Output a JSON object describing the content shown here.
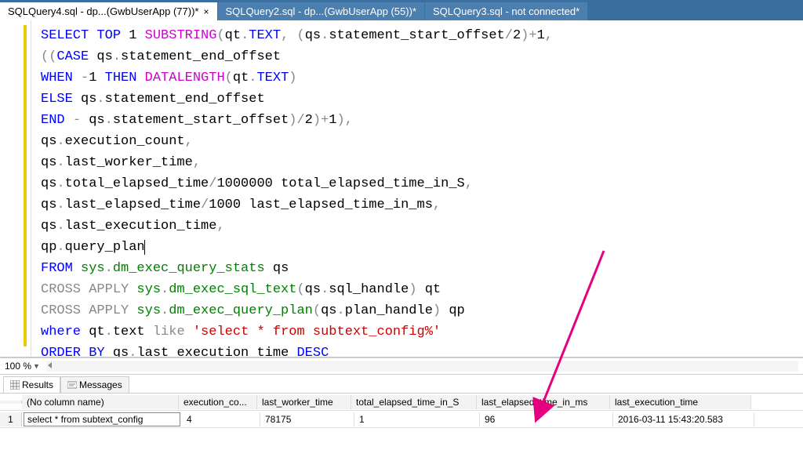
{
  "tabs": [
    {
      "label": "SQLQuery4.sql - dp...(GwbUserApp (77))*",
      "active": true
    },
    {
      "label": "SQLQuery2.sql - dp...(GwbUserApp (55))*",
      "active": false
    },
    {
      "label": "SQLQuery3.sql - not connected*",
      "active": false
    }
  ],
  "zoom": "100 %",
  "panels": {
    "results": "Results",
    "messages": "Messages"
  },
  "code_tokens": [
    [
      [
        "kw",
        "SELECT"
      ],
      [
        "",
        ""
      ],
      [
        "kw",
        "TOP"
      ],
      [
        "",
        " "
      ],
      [
        "num",
        "1"
      ],
      [
        "",
        " "
      ],
      [
        "fn",
        "SUBSTRING"
      ],
      [
        "punct",
        "("
      ],
      [
        "ident",
        "qt"
      ],
      [
        "punct",
        "."
      ],
      [
        "kw",
        "TEXT"
      ],
      [
        "punct",
        ","
      ],
      [
        "",
        " "
      ],
      [
        "punct",
        "("
      ],
      [
        "ident",
        "qs"
      ],
      [
        "punct",
        "."
      ],
      [
        "ident",
        "statement_start_offset"
      ],
      [
        "op",
        "/"
      ],
      [
        "num",
        "2"
      ],
      [
        "punct",
        ")"
      ],
      [
        "op",
        "+"
      ],
      [
        "num",
        "1"
      ],
      [
        "punct",
        ","
      ]
    ],
    [
      [
        "punct",
        "(("
      ],
      [
        "kw",
        "CASE"
      ],
      [
        "",
        " "
      ],
      [
        "ident",
        "qs"
      ],
      [
        "punct",
        "."
      ],
      [
        "ident",
        "statement_end_offset"
      ]
    ],
    [
      [
        "kw",
        "WHEN"
      ],
      [
        "",
        " "
      ],
      [
        "op",
        "-"
      ],
      [
        "num",
        "1"
      ],
      [
        "",
        " "
      ],
      [
        "kw",
        "THEN"
      ],
      [
        "",
        " "
      ],
      [
        "fn",
        "DATALENGTH"
      ],
      [
        "punct",
        "("
      ],
      [
        "ident",
        "qt"
      ],
      [
        "punct",
        "."
      ],
      [
        "kw",
        "TEXT"
      ],
      [
        "punct",
        ")"
      ]
    ],
    [
      [
        "kw",
        "ELSE"
      ],
      [
        "",
        " "
      ],
      [
        "ident",
        "qs"
      ],
      [
        "punct",
        "."
      ],
      [
        "ident",
        "statement_end_offset"
      ]
    ],
    [
      [
        "kw",
        "END"
      ],
      [
        "",
        " "
      ],
      [
        "op",
        "-"
      ],
      [
        "",
        " "
      ],
      [
        "ident",
        "qs"
      ],
      [
        "punct",
        "."
      ],
      [
        "ident",
        "statement_start_offset"
      ],
      [
        "punct",
        ")"
      ],
      [
        "op",
        "/"
      ],
      [
        "num",
        "2"
      ],
      [
        "punct",
        ")"
      ],
      [
        "op",
        "+"
      ],
      [
        "num",
        "1"
      ],
      [
        "punct",
        ")"
      ],
      [
        "punct",
        ","
      ]
    ],
    [
      [
        "ident",
        "qs"
      ],
      [
        "punct",
        "."
      ],
      [
        "ident",
        "execution_count"
      ],
      [
        "punct",
        ","
      ]
    ],
    [
      [
        "ident",
        "qs"
      ],
      [
        "punct",
        "."
      ],
      [
        "ident",
        "last_worker_time"
      ],
      [
        "punct",
        ","
      ]
    ],
    [
      [
        "ident",
        "qs"
      ],
      [
        "punct",
        "."
      ],
      [
        "ident",
        "total_elapsed_time"
      ],
      [
        "op",
        "/"
      ],
      [
        "num",
        "1000000"
      ],
      [
        "",
        " "
      ],
      [
        "ident",
        "total_elapsed_time_in_S"
      ],
      [
        "punct",
        ","
      ]
    ],
    [
      [
        "ident",
        "qs"
      ],
      [
        "punct",
        "."
      ],
      [
        "ident",
        "last_elapsed_time"
      ],
      [
        "op",
        "/"
      ],
      [
        "num",
        "1000"
      ],
      [
        "",
        " "
      ],
      [
        "ident",
        "last_elapsed_time_in_ms"
      ],
      [
        "punct",
        ","
      ]
    ],
    [
      [
        "ident",
        "qs"
      ],
      [
        "punct",
        "."
      ],
      [
        "ident",
        "last_execution_time"
      ],
      [
        "punct",
        ","
      ]
    ],
    [
      [
        "ident",
        "qp"
      ],
      [
        "punct",
        "."
      ],
      [
        "ident",
        "query_plan"
      ],
      [
        "caret",
        ""
      ]
    ],
    [
      [
        "kw",
        "FROM"
      ],
      [
        "",
        " "
      ],
      [
        "sys",
        "sys"
      ],
      [
        "punct",
        "."
      ],
      [
        "sys",
        "dm_exec_query_stats"
      ],
      [
        "",
        " "
      ],
      [
        "ident",
        "qs"
      ]
    ],
    [
      [
        "op",
        "CROSS APPLY"
      ],
      [
        "",
        " "
      ],
      [
        "sys",
        "sys"
      ],
      [
        "punct",
        "."
      ],
      [
        "sys",
        "dm_exec_sql_text"
      ],
      [
        "punct",
        "("
      ],
      [
        "ident",
        "qs"
      ],
      [
        "punct",
        "."
      ],
      [
        "ident",
        "sql_handle"
      ],
      [
        "punct",
        ")"
      ],
      [
        "",
        " "
      ],
      [
        "ident",
        "qt"
      ]
    ],
    [
      [
        "op",
        "CROSS APPLY"
      ],
      [
        "",
        " "
      ],
      [
        "sys",
        "sys"
      ],
      [
        "punct",
        "."
      ],
      [
        "sys",
        "dm_exec_query_plan"
      ],
      [
        "punct",
        "("
      ],
      [
        "ident",
        "qs"
      ],
      [
        "punct",
        "."
      ],
      [
        "ident",
        "plan_handle"
      ],
      [
        "punct",
        ")"
      ],
      [
        "",
        " "
      ],
      [
        "ident",
        "qp"
      ]
    ],
    [
      [
        "kw",
        "where"
      ],
      [
        "",
        " "
      ],
      [
        "ident",
        "qt"
      ],
      [
        "punct",
        "."
      ],
      [
        "ident",
        "text"
      ],
      [
        "",
        " "
      ],
      [
        "op",
        "like"
      ],
      [
        "",
        " "
      ],
      [
        "str",
        "'select * from subtext_config%'"
      ]
    ],
    [
      [
        "kw",
        "ORDER"
      ],
      [
        "",
        " "
      ],
      [
        "kw",
        "BY"
      ],
      [
        "",
        " "
      ],
      [
        "ident",
        "qs"
      ],
      [
        "punct",
        "."
      ],
      [
        "ident",
        "last_execution_time"
      ],
      [
        "",
        " "
      ],
      [
        "kw",
        "DESC"
      ]
    ]
  ],
  "grid": {
    "headers": [
      "(No column name)",
      "execution_co...",
      "last_worker_time",
      "total_elapsed_time_in_S",
      "last_elapsed_time_in_ms",
      "last_execution_time"
    ],
    "row_num": "1",
    "row": [
      "select * from subtext_config",
      "4",
      "78175",
      "1",
      "96",
      "2016-03-11 15:43:20.583"
    ]
  }
}
